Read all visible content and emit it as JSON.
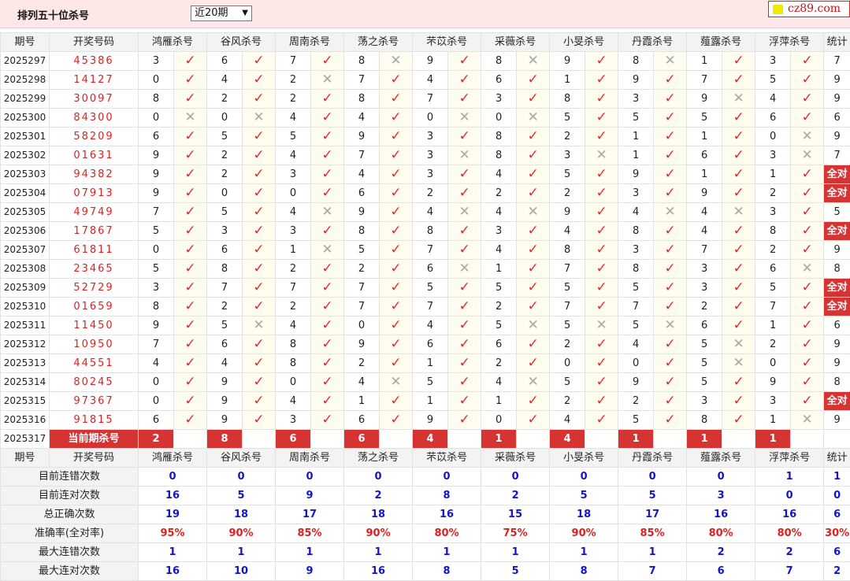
{
  "header": {
    "title": "排列五十位杀号",
    "select_value": "近20期",
    "logo_text": "cz89.com"
  },
  "columns": {
    "period": "期号",
    "draw": "开奖号码",
    "experts": [
      "鸿雁杀号",
      "谷风杀号",
      "周南杀号",
      "荡之杀号",
      "芣苡杀号",
      "采薇杀号",
      "小旻杀号",
      "丹霞杀号",
      "薤露杀号",
      "浮萍杀号"
    ],
    "stats": "统计"
  },
  "rows": [
    {
      "period": "2025297",
      "draw": "45386",
      "kills": [
        3,
        6,
        7,
        8,
        9,
        8,
        9,
        8,
        1,
        3
      ],
      "ok": [
        1,
        1,
        1,
        0,
        1,
        0,
        1,
        0,
        1,
        1
      ],
      "count": "7"
    },
    {
      "period": "2025298",
      "draw": "14127",
      "kills": [
        0,
        4,
        2,
        7,
        4,
        6,
        1,
        9,
        7,
        5
      ],
      "ok": [
        1,
        1,
        0,
        1,
        1,
        1,
        1,
        1,
        1,
        1
      ],
      "count": "9"
    },
    {
      "period": "2025299",
      "draw": "30097",
      "kills": [
        8,
        2,
        2,
        8,
        7,
        3,
        8,
        3,
        9,
        4
      ],
      "ok": [
        1,
        1,
        1,
        1,
        1,
        1,
        1,
        1,
        0,
        1
      ],
      "count": "9"
    },
    {
      "period": "2025300",
      "draw": "84300",
      "kills": [
        0,
        0,
        4,
        4,
        0,
        0,
        5,
        5,
        5,
        6
      ],
      "ok": [
        0,
        0,
        1,
        1,
        0,
        0,
        1,
        1,
        1,
        1
      ],
      "count": "6"
    },
    {
      "period": "2025301",
      "draw": "58209",
      "kills": [
        6,
        5,
        5,
        9,
        3,
        8,
        2,
        1,
        1,
        0
      ],
      "ok": [
        1,
        1,
        1,
        1,
        1,
        1,
        1,
        1,
        1,
        0
      ],
      "count": "9"
    },
    {
      "period": "2025302",
      "draw": "01631",
      "kills": [
        9,
        2,
        4,
        7,
        3,
        8,
        3,
        1,
        6,
        3
      ],
      "ok": [
        1,
        1,
        1,
        1,
        0,
        1,
        0,
        1,
        1,
        0
      ],
      "count": "7"
    },
    {
      "period": "2025303",
      "draw": "94382",
      "kills": [
        9,
        2,
        3,
        4,
        3,
        4,
        5,
        9,
        1,
        1
      ],
      "ok": [
        1,
        1,
        1,
        1,
        1,
        1,
        1,
        1,
        1,
        1
      ],
      "count": "全对"
    },
    {
      "period": "2025304",
      "draw": "07913",
      "kills": [
        9,
        0,
        0,
        6,
        2,
        2,
        2,
        3,
        9,
        2
      ],
      "ok": [
        1,
        1,
        1,
        1,
        1,
        1,
        1,
        1,
        1,
        1
      ],
      "count": "全对"
    },
    {
      "period": "2025305",
      "draw": "49749",
      "kills": [
        7,
        5,
        4,
        9,
        4,
        4,
        9,
        4,
        4,
        3
      ],
      "ok": [
        1,
        1,
        0,
        1,
        0,
        0,
        1,
        0,
        0,
        1
      ],
      "count": "5"
    },
    {
      "period": "2025306",
      "draw": "17867",
      "kills": [
        5,
        3,
        3,
        8,
        8,
        3,
        4,
        8,
        4,
        8
      ],
      "ok": [
        1,
        1,
        1,
        1,
        1,
        1,
        1,
        1,
        1,
        1
      ],
      "count": "全对"
    },
    {
      "period": "2025307",
      "draw": "61811",
      "kills": [
        0,
        6,
        1,
        5,
        7,
        4,
        8,
        3,
        7,
        2
      ],
      "ok": [
        1,
        1,
        0,
        1,
        1,
        1,
        1,
        1,
        1,
        1
      ],
      "count": "9"
    },
    {
      "period": "2025308",
      "draw": "23465",
      "kills": [
        5,
        8,
        2,
        2,
        6,
        1,
        7,
        8,
        3,
        6
      ],
      "ok": [
        1,
        1,
        1,
        1,
        0,
        1,
        1,
        1,
        1,
        0
      ],
      "count": "8"
    },
    {
      "period": "2025309",
      "draw": "52729",
      "kills": [
        3,
        7,
        7,
        7,
        5,
        5,
        5,
        5,
        3,
        5
      ],
      "ok": [
        1,
        1,
        1,
        1,
        1,
        1,
        1,
        1,
        1,
        1
      ],
      "count": "全对"
    },
    {
      "period": "2025310",
      "draw": "01659",
      "kills": [
        8,
        2,
        2,
        7,
        7,
        2,
        7,
        7,
        2,
        7
      ],
      "ok": [
        1,
        1,
        1,
        1,
        1,
        1,
        1,
        1,
        1,
        1
      ],
      "count": "全对"
    },
    {
      "period": "2025311",
      "draw": "11450",
      "kills": [
        9,
        5,
        4,
        0,
        4,
        5,
        5,
        5,
        6,
        1
      ],
      "ok": [
        1,
        0,
        1,
        1,
        1,
        0,
        0,
        0,
        1,
        1
      ],
      "count": "6"
    },
    {
      "period": "2025312",
      "draw": "10950",
      "kills": [
        7,
        6,
        8,
        9,
        6,
        6,
        2,
        4,
        5,
        2
      ],
      "ok": [
        1,
        1,
        1,
        1,
        1,
        1,
        1,
        1,
        0,
        1
      ],
      "count": "9"
    },
    {
      "period": "2025313",
      "draw": "44551",
      "kills": [
        4,
        4,
        8,
        2,
        1,
        2,
        0,
        0,
        5,
        0
      ],
      "ok": [
        1,
        1,
        1,
        1,
        1,
        1,
        1,
        1,
        0,
        1
      ],
      "count": "9"
    },
    {
      "period": "2025314",
      "draw": "80245",
      "kills": [
        0,
        9,
        0,
        4,
        5,
        4,
        5,
        9,
        5,
        9
      ],
      "ok": [
        1,
        1,
        1,
        0,
        1,
        0,
        1,
        1,
        1,
        1
      ],
      "count": "8"
    },
    {
      "period": "2025315",
      "draw": "97367",
      "kills": [
        0,
        9,
        4,
        1,
        1,
        1,
        2,
        2,
        3,
        3
      ],
      "ok": [
        1,
        1,
        1,
        1,
        1,
        1,
        1,
        1,
        1,
        1
      ],
      "count": "全对"
    },
    {
      "period": "2025316",
      "draw": "91815",
      "kills": [
        6,
        9,
        3,
        6,
        9,
        0,
        4,
        5,
        8,
        1
      ],
      "ok": [
        1,
        1,
        1,
        1,
        1,
        1,
        1,
        1,
        1,
        0
      ],
      "count": "9"
    }
  ],
  "current": {
    "period": "2025317",
    "label": "当前期杀号",
    "kills": [
      2,
      8,
      6,
      6,
      4,
      1,
      4,
      1,
      1,
      1
    ]
  },
  "marks": {
    "ok": "✓",
    "bad": "✕"
  },
  "stats": [
    {
      "label": "目前连错次数",
      "values": [
        "0",
        "0",
        "0",
        "0",
        "0",
        "0",
        "0",
        "0",
        "0",
        "1",
        "1"
      ],
      "red": false
    },
    {
      "label": "目前连对次数",
      "values": [
        "16",
        "5",
        "9",
        "2",
        "8",
        "2",
        "5",
        "5",
        "3",
        "0",
        "0"
      ],
      "red": false
    },
    {
      "label": "总正确次数",
      "values": [
        "19",
        "18",
        "17",
        "18",
        "16",
        "15",
        "18",
        "17",
        "16",
        "16",
        "6"
      ],
      "red": false
    },
    {
      "label": "准确率(全对率)",
      "values": [
        "95%",
        "90%",
        "85%",
        "90%",
        "80%",
        "75%",
        "90%",
        "85%",
        "80%",
        "80%",
        "30%"
      ],
      "red": true
    },
    {
      "label": "最大连错次数",
      "values": [
        "1",
        "1",
        "1",
        "1",
        "1",
        "1",
        "1",
        "1",
        "2",
        "2",
        "6"
      ],
      "red": false
    },
    {
      "label": "最大连对次数",
      "values": [
        "16",
        "10",
        "9",
        "16",
        "8",
        "5",
        "8",
        "7",
        "6",
        "7",
        "2"
      ],
      "red": false
    }
  ],
  "colors": {
    "accent_red": "#d63333",
    "mark_red": "#e8282e",
    "stat_blue": "#1414c8",
    "header_bg": "#fde7e7"
  }
}
